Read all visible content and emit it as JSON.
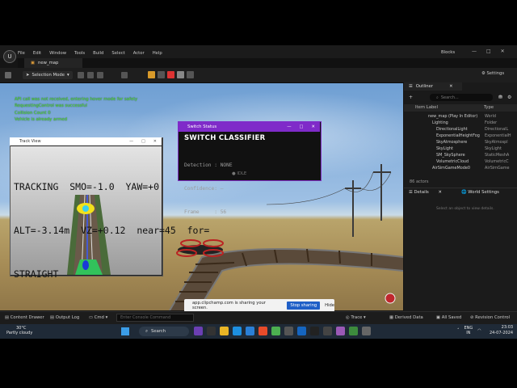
{
  "editor": {
    "menu": [
      "File",
      "Edit",
      "Window",
      "Tools",
      "Build",
      "Select",
      "Actor",
      "Help"
    ],
    "map_tab": "new_map",
    "project_name": "Blocks",
    "selection_mode": "Selection Mode",
    "settings_label": "Settings",
    "window_controls": [
      "—",
      "□",
      "✕"
    ]
  },
  "viewport": {
    "log_lines": [
      "API call was not received, entering hover mode for safety",
      "RequestingControl was successful",
      "Collision Count 0",
      "Vehicle is already armed"
    ]
  },
  "track_view": {
    "title": "Track View",
    "line1": "TRACKING  SMO=-1.0  YAW=+0",
    "line2": "ALT=-3.14m  VZ=+0.12  near=45  for=",
    "line3": "STRAIGHT"
  },
  "switch_status": {
    "title": "Switch Status",
    "heading": "SWITCH CLASSIFIER",
    "detection": "Detection : NONE",
    "confidence": "Confidence: —",
    "frame": "Frame     : 56",
    "state": "IDLE"
  },
  "outliner": {
    "tab": "Outliner",
    "search_placeholder": "Search...",
    "col_label": "Item Label",
    "col_type": "Type",
    "rows": [
      {
        "label": "new_map (Play In Editor)",
        "type": "World"
      },
      {
        "label": "Lighting",
        "type": "Folder"
      },
      {
        "label": "DirectionalLight",
        "type": "DirectionalL"
      },
      {
        "label": "ExponentialHeightFog",
        "type": "ExponentialH"
      },
      {
        "label": "SkyAtmosphere",
        "type": "SkyAtmospl"
      },
      {
        "label": "SkyLight",
        "type": "SkyLight"
      },
      {
        "label": "SM_SkySphere",
        "type": "StaticMeshA"
      },
      {
        "label": "VolumetricCloud",
        "type": "VolumetricC"
      },
      {
        "label": "AirSimGameMode0",
        "type": "AirSimGame"
      }
    ],
    "actors_count": "86 actors"
  },
  "details": {
    "tab": "Details",
    "world_settings_tab": "World Settings",
    "empty_text": "Select an object to view details."
  },
  "status_bar": {
    "content_drawer": "Content Drawer",
    "output_log": "Output Log",
    "cmd": "Cmd",
    "cmd_placeholder": "Enter Console Command",
    "trace": "Trace",
    "derived_data": "Derived Data",
    "all_saved": "All Saved",
    "revision_control": "Revision Control"
  },
  "share_bar": {
    "text": "app.clipchamp.com is sharing your screen.",
    "stop_label": "Stop sharing",
    "hide_label": "Hide"
  },
  "taskbar": {
    "temp": "30°C",
    "weather": "Partly cloudy",
    "search_label": "Search",
    "lang": "ENG",
    "region": "IN",
    "time": "23:03",
    "date": "24-07-2024"
  }
}
